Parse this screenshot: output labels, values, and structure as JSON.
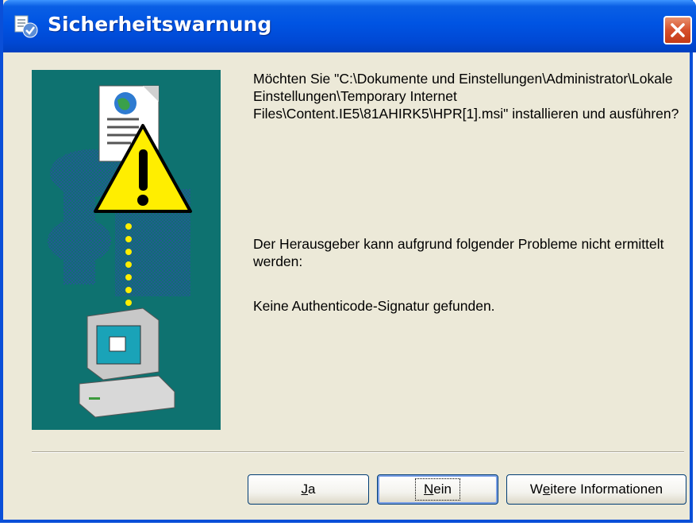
{
  "window": {
    "title": "Sicherheitswarnung"
  },
  "message": {
    "question": "Möchten Sie \"C:\\Dokumente und Einstellungen\\Administrator\\Lokale Einstellungen\\Temporary Internet Files\\Content.IE5\\81AHIRK5\\HPR[1].msi\" installieren und ausführen?",
    "publisher_problem": "Der Herausgeber kann aufgrund folgender Probleme nicht ermittelt werden:",
    "signature_status": "Keine Authenticode-Signatur gefunden."
  },
  "buttons": {
    "ja": {
      "accel": "J",
      "rest": "a"
    },
    "nein": {
      "accel": "N",
      "rest": "ein"
    },
    "info": {
      "before": "W",
      "accel": "e",
      "rest": "itere Informationen"
    }
  },
  "colors": {
    "titlebar": "#0054e3",
    "dialog_bg": "#ece9d8",
    "illustration_bg": "#0e7270",
    "close_button": "#d6502c"
  },
  "icons": {
    "title": "security-shield-icon",
    "close": "close-icon",
    "illustration": "warning-download-illustration"
  }
}
